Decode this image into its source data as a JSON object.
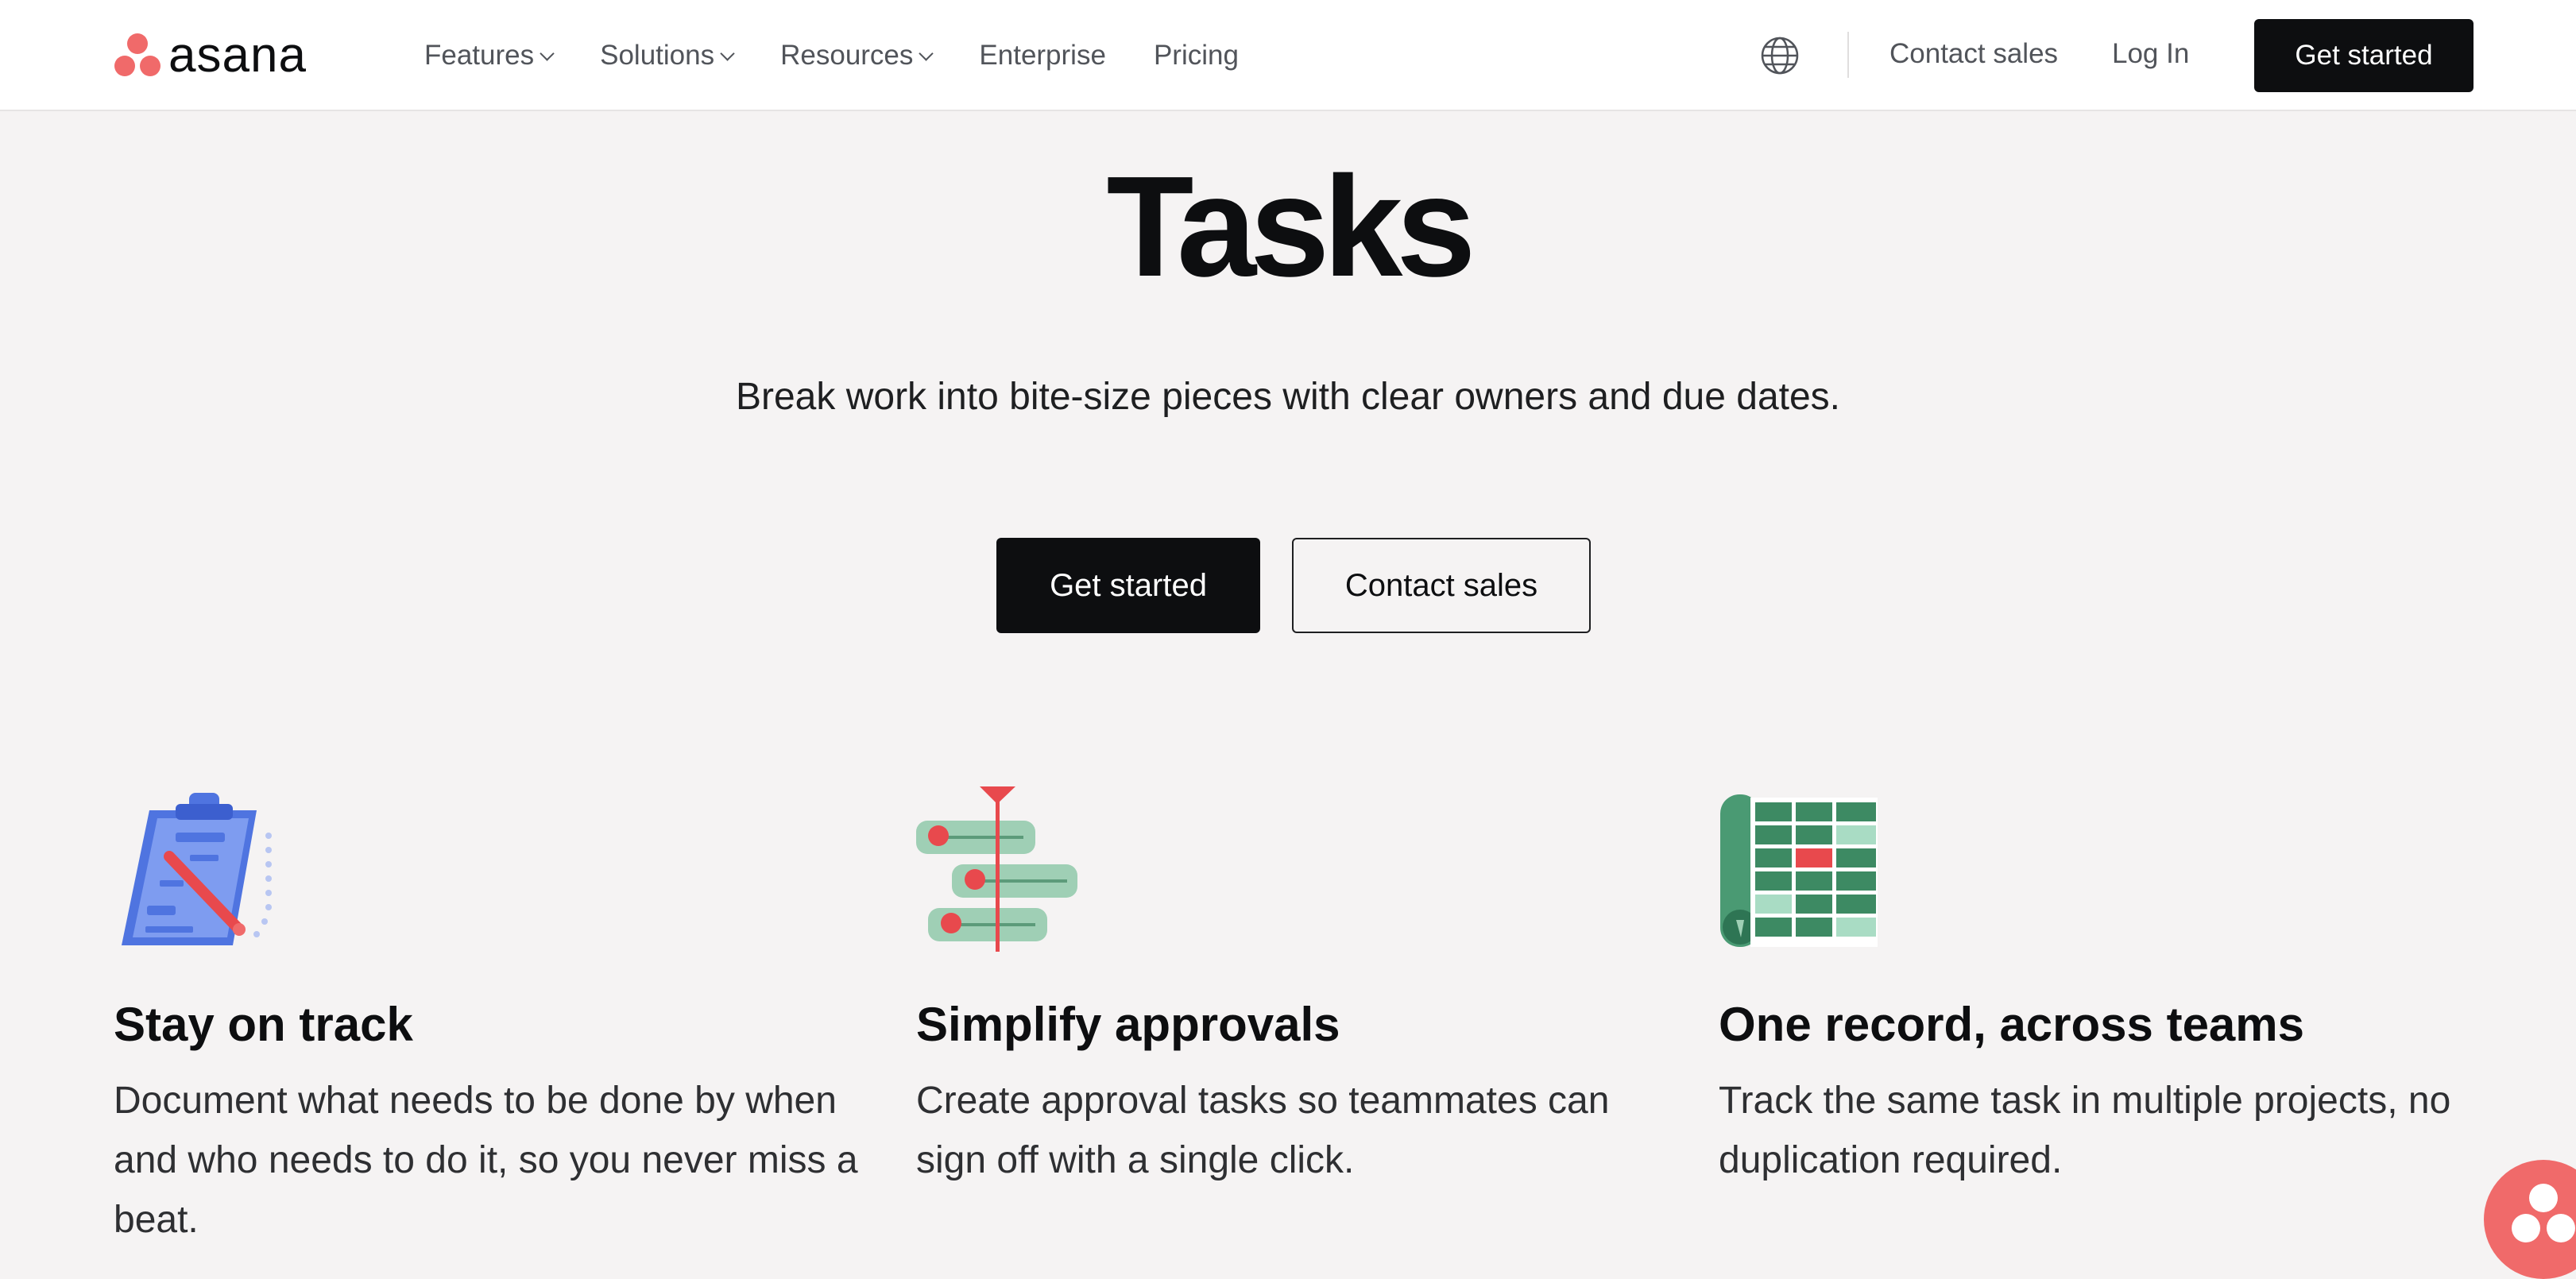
{
  "brand": {
    "name": "asana",
    "accent": "#f06a6a"
  },
  "nav": {
    "items": [
      {
        "label": "Features",
        "has_dropdown": true
      },
      {
        "label": "Solutions",
        "has_dropdown": true
      },
      {
        "label": "Resources",
        "has_dropdown": true
      },
      {
        "label": "Enterprise",
        "has_dropdown": false
      },
      {
        "label": "Pricing",
        "has_dropdown": false
      }
    ],
    "globe_icon": "globe-icon",
    "contact_sales": "Contact sales",
    "login": "Log In",
    "cta": "Get started"
  },
  "hero": {
    "title": "Tasks",
    "subtitle": "Break work into bite-size pieces with clear owners and due dates.",
    "primary_button": "Get started",
    "secondary_button": "Contact sales"
  },
  "features": [
    {
      "icon": "clipboard-icon",
      "title": "Stay on track",
      "description": "Document what needs to be done by when and who needs to do it, so you never miss a beat."
    },
    {
      "icon": "approval-timeline-icon",
      "title": "Simplify approvals",
      "description": "Create approval tasks so teammates can sign off with a single click."
    },
    {
      "icon": "spreadsheet-record-icon",
      "title": "One record, across teams",
      "description": "Track the same task in multiple projects, no duplication required."
    }
  ],
  "help_widget": {
    "icon": "asana-help-icon"
  }
}
